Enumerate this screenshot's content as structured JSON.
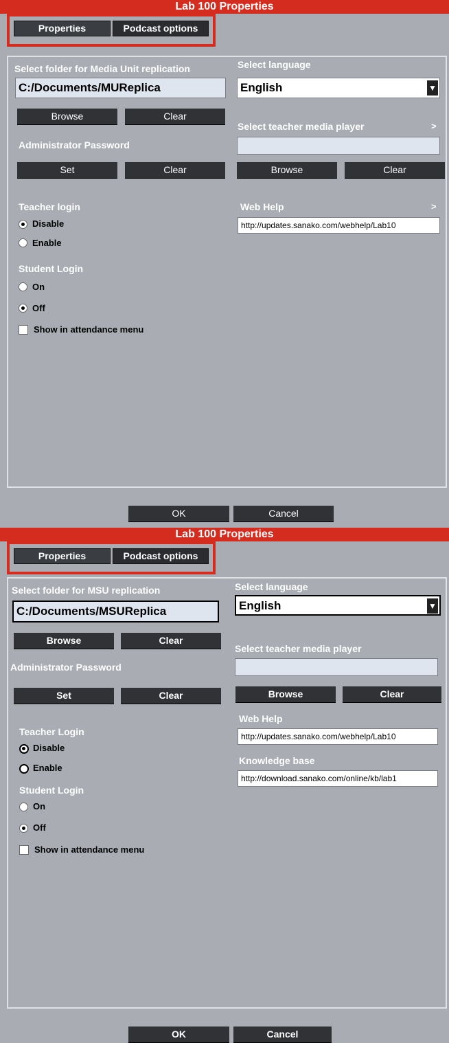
{
  "dialog1": {
    "title": "Lab 100 Properties",
    "tabs": [
      {
        "label": "Properties"
      },
      {
        "label": "Podcast options"
      }
    ],
    "replication_label": "Select folder for Media Unit replication",
    "replication_value": "C:/Documents/MUReplica",
    "browse_label": "Browse",
    "clear_label": "Clear",
    "admin_password_label": "Administrator Password",
    "set_label": "Set",
    "admin_clear_label": "Clear",
    "teacher_login_label": "Teacher login",
    "teacher_options": [
      {
        "label": "Disable",
        "selected": true
      },
      {
        "label": "Enable",
        "selected": false
      }
    ],
    "student_login_label": "Student Login",
    "student_options": [
      {
        "label": "On",
        "selected": false
      },
      {
        "label": "Off",
        "selected": true
      }
    ],
    "attendance_label": "Show in attendance menu",
    "language_label": "Select language",
    "language_value": "English",
    "media_player_label": "Select teacher media player",
    "media_player_value": "",
    "player_browse_label": "Browse",
    "player_clear_label": "Clear",
    "webhelp_label": "Web Help",
    "webhelp_value": "http://updates.sanako.com/webhelp/Lab10",
    "chevron": ">",
    "ok_label": "OK",
    "cancel_label": "Cancel"
  },
  "dialog2": {
    "title": "Lab 100 Properties",
    "tabs": [
      {
        "label": "Properties"
      },
      {
        "label": "Podcast options"
      }
    ],
    "replication_label": "Select folder for MSU replication",
    "replication_value": "C:/Documents/MSUReplica",
    "browse_label": "Browse",
    "clear_label": "Clear",
    "admin_password_label": "Administrator Password",
    "set_label": "Set",
    "admin_clear_label": "Clear",
    "teacher_login_label": "Teacher Login",
    "teacher_options": [
      {
        "label": "Disable",
        "selected": true
      },
      {
        "label": "Enable",
        "selected": false
      }
    ],
    "student_login_label": "Student Login",
    "student_options": [
      {
        "label": "On",
        "selected": false
      },
      {
        "label": "Off",
        "selected": true
      }
    ],
    "attendance_label": "Show in attendance menu",
    "language_label": "Select language",
    "language_value": "English",
    "media_player_label": "Select teacher media player",
    "media_player_value": "",
    "player_browse_label": "Browse",
    "player_clear_label": "Clear",
    "webhelp_label": "Web Help",
    "webhelp_value": "http://updates.sanako.com/webhelp/Lab10",
    "knowledge_label": "Knowledge base",
    "knowledge_value": "http://download.sanako.com/online/kb/lab1",
    "ok_label": "OK",
    "cancel_label": "Cancel"
  },
  "colors": {
    "title_bar": "#d42d1f",
    "background": "#a9adb3",
    "button": "#303236"
  },
  "icons": {
    "dropdown": "dropdown-arrow-icon",
    "chevron": "chevron-right-icon"
  }
}
